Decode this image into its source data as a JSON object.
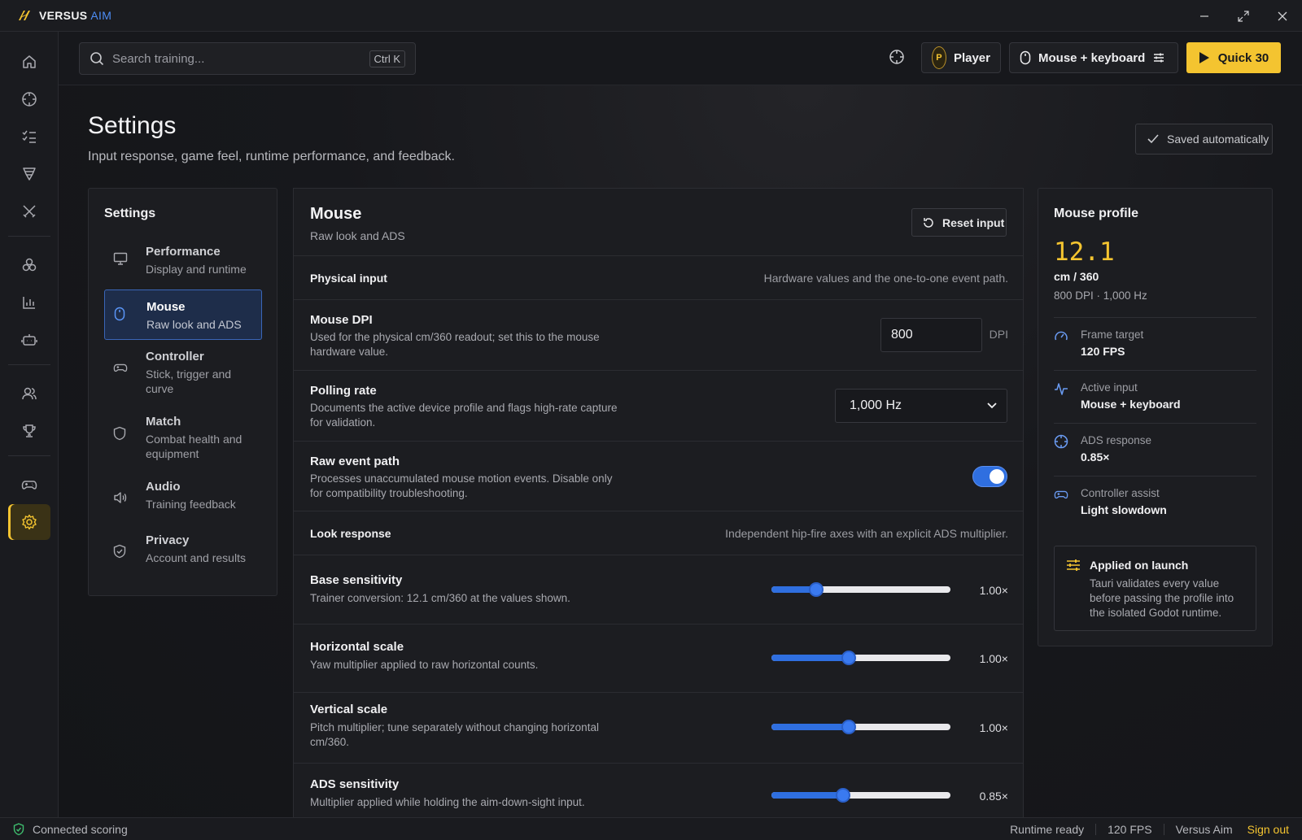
{
  "app": {
    "brand_primary": "VERSUS",
    "brand_accent": "AIM",
    "accent_color": "#f4c430",
    "primary_blue": "#2f6fe0"
  },
  "topbar": {
    "search_placeholder": "Search training...",
    "search_shortcut": "Ctrl K",
    "player_initial": "P",
    "player_label": "Player",
    "input_mode_label": "Mouse + keyboard",
    "quick_label": "Quick 30"
  },
  "page": {
    "title": "Settings",
    "subtitle": "Input response, game feel, runtime performance, and feedback.",
    "saved_label": "Saved automatically"
  },
  "nav": {
    "title": "Settings",
    "items": [
      {
        "label": "Performance",
        "desc": "Display and runtime",
        "icon": "monitor-icon"
      },
      {
        "label": "Mouse",
        "desc": "Raw look and ADS",
        "icon": "mouse-icon"
      },
      {
        "label": "Controller",
        "desc": "Stick, trigger and curve",
        "icon": "gamepad-icon"
      },
      {
        "label": "Match",
        "desc": "Combat health and equipment",
        "icon": "shield-icon"
      },
      {
        "label": "Audio",
        "desc": "Training feedback",
        "icon": "speaker-icon"
      },
      {
        "label": "Privacy",
        "desc": "Account and results",
        "icon": "shield-check-icon"
      }
    ],
    "active_index": 1
  },
  "main": {
    "title": "Mouse",
    "subtitle": "Raw look and ADS",
    "reset_label": "Reset input",
    "physical": {
      "title": "Physical input",
      "note": "Hardware values and the one-to-one event path."
    },
    "dpi": {
      "title": "Mouse DPI",
      "desc": "Used for the physical cm/360 readout; set this to the mouse hardware value.",
      "value": "800",
      "unit": "DPI"
    },
    "polling": {
      "title": "Polling rate",
      "desc": "Documents the active device profile and flags high-rate capture for validation.",
      "value": "1,000 Hz"
    },
    "raw": {
      "title": "Raw event path",
      "desc": "Processes unaccumulated mouse motion events. Disable only for compatibility troubleshooting.",
      "enabled": true
    },
    "look": {
      "title": "Look response",
      "note": "Independent hip-fire axes with an explicit ADS multiplier."
    },
    "sliders": [
      {
        "title": "Base sensitivity",
        "desc": "Trainer conversion: 12.1 cm/360 at the values shown.",
        "value_label": "1.00×",
        "fraction": 0.25
      },
      {
        "title": "Horizontal scale",
        "desc": "Yaw multiplier applied to raw horizontal counts.",
        "value_label": "1.00×",
        "fraction": 0.43
      },
      {
        "title": "Vertical scale",
        "desc": "Pitch multiplier; tune separately without changing horizontal cm/360.",
        "value_label": "1.00×",
        "fraction": 0.43
      },
      {
        "title": "ADS sensitivity",
        "desc": "Multiplier applied while holding the aim-down-sight input.",
        "value_label": "0.85×",
        "fraction": 0.4
      }
    ]
  },
  "profile": {
    "title": "Mouse profile",
    "big_value": "12.1",
    "unit": "cm / 360",
    "meta": "800 DPI · 1,000 Hz",
    "items": [
      {
        "label": "Frame target",
        "value": "120 FPS",
        "icon": "gauge-icon"
      },
      {
        "label": "Active input",
        "value": "Mouse + keyboard",
        "icon": "activity-icon"
      },
      {
        "label": "ADS response",
        "value": "0.85×",
        "icon": "crosshair-icon"
      },
      {
        "label": "Controller assist",
        "value": "Light slowdown",
        "icon": "gamepad-icon"
      }
    ],
    "launch_title": "Applied on launch",
    "launch_text": "Tauri validates every value before passing the profile into the isolated Godot runtime."
  },
  "status": {
    "left": "Connected scoring",
    "runtime": "Runtime ready",
    "fps": "120 FPS",
    "app_name": "Versus Aim",
    "signout": "Sign out"
  }
}
